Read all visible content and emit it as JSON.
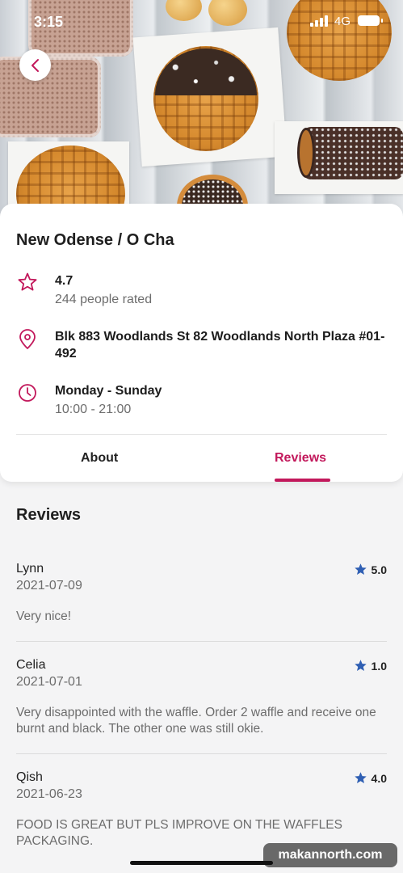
{
  "status_bar": {
    "time": "3:15",
    "network": "4G"
  },
  "restaurant": {
    "name": "New Odense / O Cha",
    "rating": "4.7",
    "rating_count": "244 people rated",
    "address": "Blk 883 Woodlands St 82 Woodlands North Plaza #01-492",
    "days": "Monday - Sunday",
    "hours": "10:00 - 21:00"
  },
  "tabs": [
    {
      "label": "About",
      "active": false
    },
    {
      "label": "Reviews",
      "active": true
    }
  ],
  "reviews_section": {
    "heading": "Reviews",
    "items": [
      {
        "name": "Lynn",
        "date": "2021-07-09",
        "rating": "5.0",
        "text": "Very nice!"
      },
      {
        "name": "Celia",
        "date": "2021-07-01",
        "rating": "1.0",
        "text": "Very disappointed with the waffle. Order 2 waffle and receive one burnt and black. The other one was still okie."
      },
      {
        "name": "Qish",
        "date": "2021-06-23",
        "rating": "4.0",
        "text": "FOOD IS GREAT BUT PLS IMPROVE ON THE WAFFLES PACKAGING."
      }
    ]
  },
  "watermark": "makannorth.com",
  "colors": {
    "accent": "#c2185b",
    "star": "#2f5fb3",
    "muted_text": "#6d6d6d"
  },
  "icons": [
    "back-chevron-icon",
    "star-outline-icon",
    "location-pin-icon",
    "clock-icon",
    "star-filled-icon",
    "signal-icon",
    "battery-icon"
  ]
}
